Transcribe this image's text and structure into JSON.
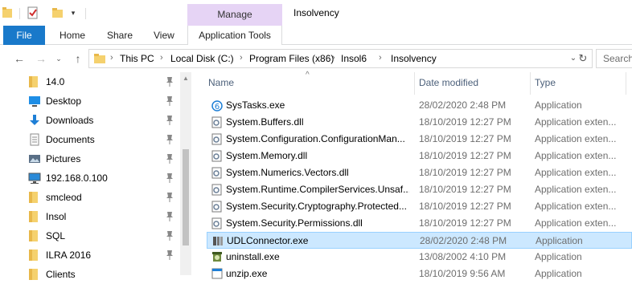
{
  "window": {
    "title": "Insolvency",
    "contextual_tab_group": "Manage"
  },
  "ribbon": {
    "tabs": [
      "File",
      "Home",
      "Share",
      "View",
      "Application Tools"
    ],
    "file_color": "#1979ca",
    "manage_color": "#e6d4f5"
  },
  "address": {
    "crumbs": [
      "This PC",
      "Local Disk (C:)",
      "Program Files (x86)",
      "Insol6",
      "Insolvency"
    ]
  },
  "search": {
    "placeholder": "Search"
  },
  "nav_pane": {
    "items": [
      {
        "label": "14.0",
        "icon": "folder-icon",
        "pinned": true
      },
      {
        "label": "Desktop",
        "icon": "desktop-icon",
        "pinned": true
      },
      {
        "label": "Downloads",
        "icon": "download-icon",
        "pinned": true
      },
      {
        "label": "Documents",
        "icon": "documents-icon",
        "pinned": true
      },
      {
        "label": "Pictures",
        "icon": "pictures-icon",
        "pinned": true
      },
      {
        "label": "192.168.0.100",
        "icon": "network-drive-icon",
        "pinned": true
      },
      {
        "label": "smcleod",
        "icon": "folder-icon",
        "pinned": true
      },
      {
        "label": "Insol",
        "icon": "folder-icon",
        "pinned": true
      },
      {
        "label": "SQL",
        "icon": "folder-icon",
        "pinned": true
      },
      {
        "label": "ILRA 2016",
        "icon": "folder-icon",
        "pinned": true
      },
      {
        "label": "Clients",
        "icon": "folder-icon",
        "pinned": true
      }
    ]
  },
  "file_list": {
    "columns": {
      "name": "Name",
      "date": "Date modified",
      "type": "Type"
    },
    "rows": [
      {
        "name": "SysTasks.exe",
        "date": "28/02/2020 2:48 PM",
        "type": "Application",
        "icon": "app-exe-icon",
        "selected": false
      },
      {
        "name": "System.Buffers.dll",
        "date": "18/10/2019 12:27 PM",
        "type": "Application exten...",
        "icon": "dll-icon",
        "selected": false
      },
      {
        "name": "System.Configuration.ConfigurationMan...",
        "date": "18/10/2019 12:27 PM",
        "type": "Application exten...",
        "icon": "dll-icon",
        "selected": false
      },
      {
        "name": "System.Memory.dll",
        "date": "18/10/2019 12:27 PM",
        "type": "Application exten...",
        "icon": "dll-icon",
        "selected": false
      },
      {
        "name": "System.Numerics.Vectors.dll",
        "date": "18/10/2019 12:27 PM",
        "type": "Application exten...",
        "icon": "dll-icon",
        "selected": false
      },
      {
        "name": "System.Runtime.CompilerServices.Unsaf...",
        "date": "18/10/2019 12:27 PM",
        "type": "Application exten...",
        "icon": "dll-icon",
        "selected": false
      },
      {
        "name": "System.Security.Cryptography.Protected...",
        "date": "18/10/2019 12:27 PM",
        "type": "Application exten...",
        "icon": "dll-icon",
        "selected": false
      },
      {
        "name": "System.Security.Permissions.dll",
        "date": "18/10/2019 12:27 PM",
        "type": "Application exten...",
        "icon": "dll-icon",
        "selected": false
      },
      {
        "name": "UDLConnector.exe",
        "date": "28/02/2020 2:48 PM",
        "type": "Application",
        "icon": "udl-exe-icon",
        "selected": true
      },
      {
        "name": "uninstall.exe",
        "date": "13/08/2002 4:10 PM",
        "type": "Application",
        "icon": "uninstall-icon",
        "selected": false
      },
      {
        "name": "unzip.exe",
        "date": "18/10/2019 9:56 AM",
        "type": "Application",
        "icon": "app-exe-icon",
        "selected": false
      }
    ]
  }
}
